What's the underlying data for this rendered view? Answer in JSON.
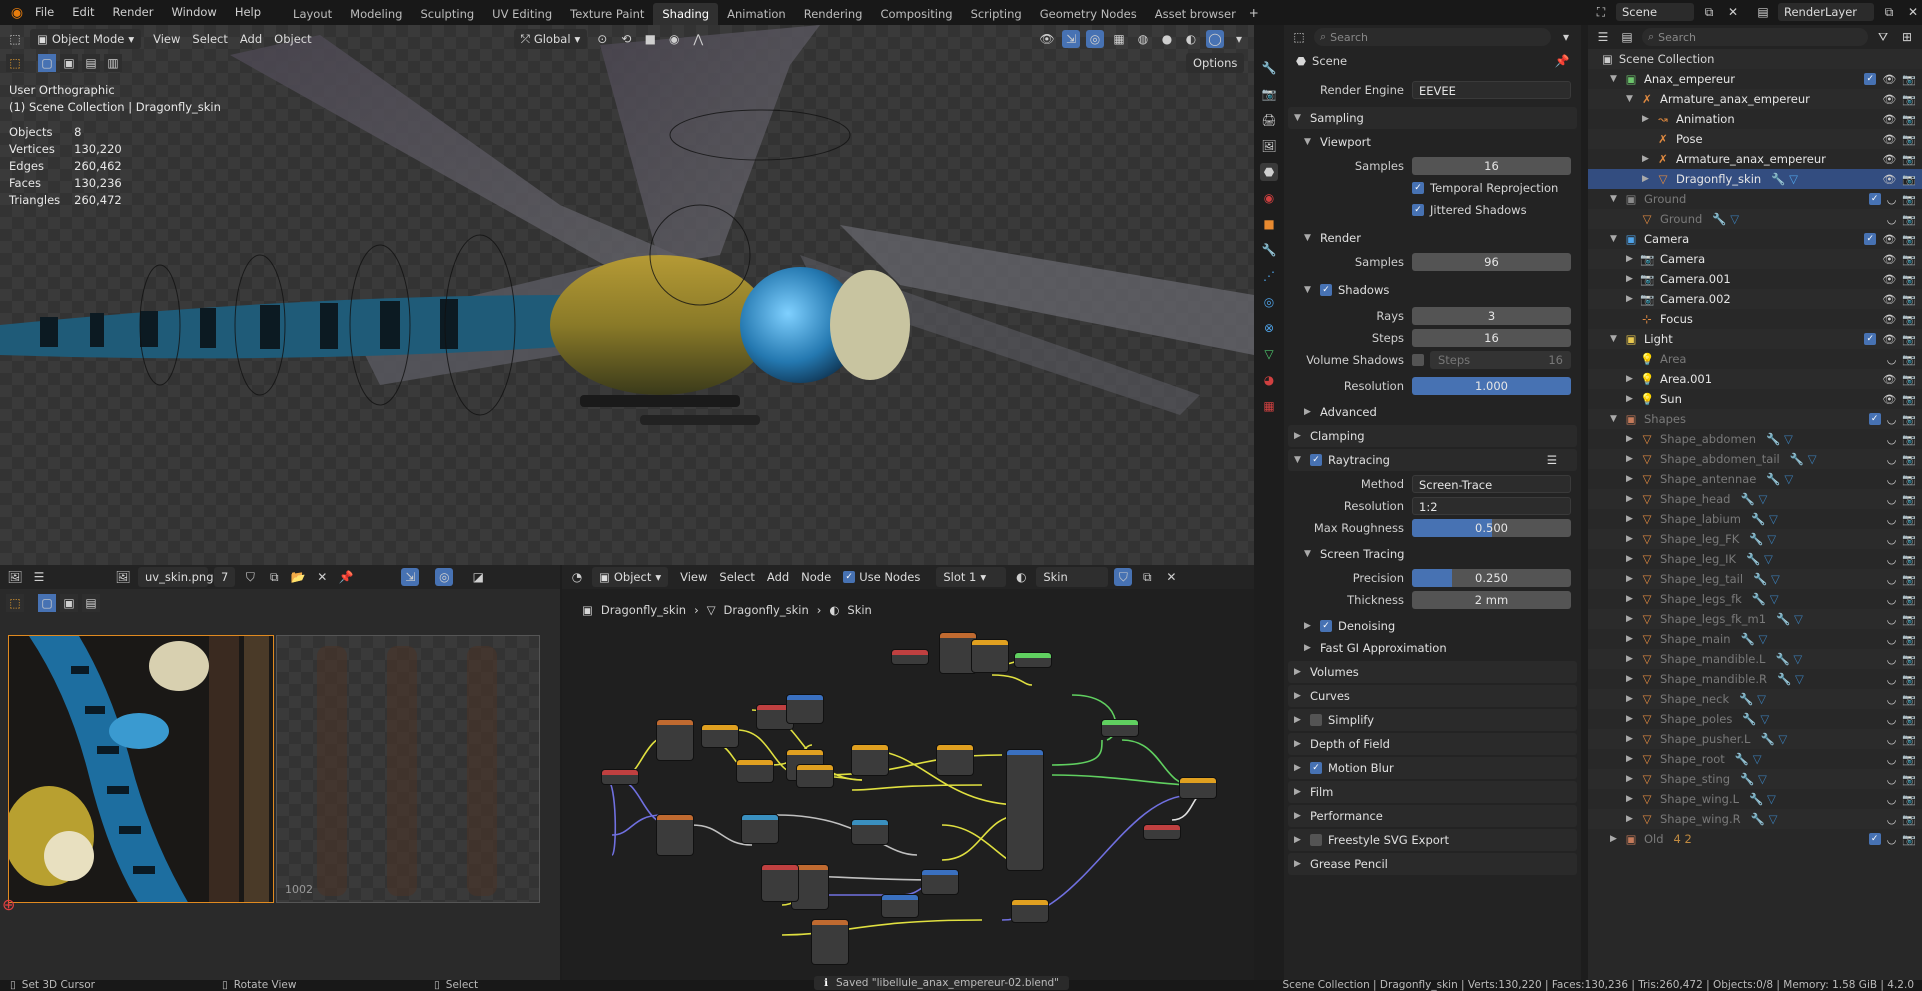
{
  "topbar": {
    "menus": [
      "File",
      "Edit",
      "Render",
      "Window",
      "Help"
    ],
    "workspaces": [
      "Layout",
      "Modeling",
      "Sculpting",
      "UV Editing",
      "Texture Paint",
      "Shading",
      "Animation",
      "Rendering",
      "Compositing",
      "Scripting",
      "Geometry Nodes",
      "Asset browser"
    ],
    "active_workspace": "Shading",
    "scene": "Scene",
    "view_layer": "RenderLayer"
  },
  "viewport": {
    "mode": "Object Mode",
    "menus": [
      "View",
      "Select",
      "Add",
      "Object"
    ],
    "transform_orientation": "Global",
    "options_label": "Options",
    "view_name": "User Orthographic",
    "collection_info": "(1) Scene Collection | Dragonfly_skin",
    "stats": [
      {
        "label": "Objects",
        "value": "8"
      },
      {
        "label": "Vertices",
        "value": "130,220"
      },
      {
        "label": "Edges",
        "value": "260,462"
      },
      {
        "label": "Faces",
        "value": "130,236"
      },
      {
        "label": "Triangles",
        "value": "260,472"
      }
    ]
  },
  "properties": {
    "search_placeholder": "Search",
    "context": "Scene",
    "render_engine_label": "Render Engine",
    "render_engine": "EEVEE",
    "sampling": "Sampling",
    "viewport": "Viewport",
    "samples_label": "Samples",
    "viewport_samples": "16",
    "temporal_reprojection": "Temporal Reprojection",
    "jittered_shadows": "Jittered Shadows",
    "render": "Render",
    "render_samples": "96",
    "shadows": "Shadows",
    "rays_label": "Rays",
    "rays": "3",
    "steps_label": "Steps",
    "steps": "16",
    "volume_shadows_label": "Volume Shadows",
    "volume_steps_label": "Steps",
    "volume_steps": "16",
    "resolution_label": "Resolution",
    "resolution": "1.000",
    "advanced": "Advanced",
    "clamping": "Clamping",
    "raytracing": "Raytracing",
    "method_label": "Method",
    "method": "Screen-Trace",
    "rt_resolution": "1:2",
    "max_roughness_label": "Max Roughness",
    "max_roughness": "0.500",
    "max_roughness_fraction": 0.5,
    "screen_tracing": "Screen Tracing",
    "precision_label": "Precision",
    "precision": "0.250",
    "precision_fraction": 0.25,
    "thickness_label": "Thickness",
    "thickness": "2 mm",
    "denoising": "Denoising",
    "fast_gi": "Fast GI Approximation",
    "panels": [
      {
        "label": "Volumes",
        "check": false
      },
      {
        "label": "Curves",
        "check": false
      },
      {
        "label": "Simplify",
        "check": "off"
      },
      {
        "label": "Depth of Field",
        "check": false
      },
      {
        "label": "Motion Blur",
        "check": "on"
      },
      {
        "label": "Film",
        "check": false
      },
      {
        "label": "Performance",
        "check": false
      },
      {
        "label": "Freestyle SVG Export",
        "check": "off"
      },
      {
        "label": "Grease Pencil",
        "check": false
      }
    ]
  },
  "outliner": {
    "search_placeholder": "Search",
    "root": "Scene Collection",
    "rows": [
      {
        "indent": 1,
        "name": "Anax_empereur",
        "type": "collection",
        "expanded": true,
        "color": "#6cc46c",
        "check": true
      },
      {
        "indent": 2,
        "name": "Armature_anax_empereur",
        "type": "armature",
        "expanded": true,
        "color": "#e8e8e8"
      },
      {
        "indent": 3,
        "name": "Animation",
        "type": "action",
        "expanded": false,
        "color": "#e8e8e8"
      },
      {
        "indent": 3,
        "name": "Pose",
        "type": "pose",
        "color": "#e8e8e8"
      },
      {
        "indent": 3,
        "name": "Armature_anax_empereur",
        "type": "armature-data",
        "expanded": false,
        "color": "#e8e8e8"
      },
      {
        "indent": 3,
        "name": "Dragonfly_skin",
        "type": "mesh",
        "expanded": false,
        "color": "#e8e8e8",
        "selected": true
      },
      {
        "indent": 1,
        "name": "Ground",
        "type": "collection",
        "expanded": true,
        "color": "#8a8a8a",
        "dim": true,
        "check": true
      },
      {
        "indent": 2,
        "name": "Ground",
        "type": "mesh",
        "color": "#8a8a8a",
        "dim": true
      },
      {
        "indent": 1,
        "name": "Camera",
        "type": "collection",
        "expanded": true,
        "color": "#4fa3e8",
        "check": true
      },
      {
        "indent": 2,
        "name": "Camera",
        "type": "camera",
        "expanded": false,
        "color": "#e8e8e8"
      },
      {
        "indent": 2,
        "name": "Camera.001",
        "type": "camera",
        "expanded": false,
        "color": "#e8e8e8"
      },
      {
        "indent": 2,
        "name": "Camera.002",
        "type": "camera",
        "expanded": false,
        "color": "#e8e8e8"
      },
      {
        "indent": 2,
        "name": "Focus",
        "type": "empty",
        "color": "#e8e8e8"
      },
      {
        "indent": 1,
        "name": "Light",
        "type": "collection",
        "expanded": true,
        "color": "#e8c84f",
        "check": true
      },
      {
        "indent": 2,
        "name": "Area",
        "type": "light",
        "color": "#8a8a8a",
        "dim": true
      },
      {
        "indent": 2,
        "name": "Area.001",
        "type": "light",
        "expanded": false,
        "color": "#e8e8e8"
      },
      {
        "indent": 2,
        "name": "Sun",
        "type": "light",
        "expanded": false,
        "color": "#e8e8e8"
      },
      {
        "indent": 1,
        "name": "Shapes",
        "type": "collection",
        "expanded": true,
        "color": "#c47a5a",
        "dim": true,
        "check": true
      },
      {
        "indent": 2,
        "name": "Shape_abdomen",
        "type": "mesh",
        "expanded": false,
        "dim": true
      },
      {
        "indent": 2,
        "name": "Shape_abdomen_tail",
        "type": "mesh",
        "expanded": false,
        "dim": true
      },
      {
        "indent": 2,
        "name": "Shape_antennae",
        "type": "mesh",
        "expanded": false,
        "dim": true
      },
      {
        "indent": 2,
        "name": "Shape_head",
        "type": "mesh",
        "expanded": false,
        "dim": true
      },
      {
        "indent": 2,
        "name": "Shape_labium",
        "type": "mesh",
        "expanded": false,
        "dim": true
      },
      {
        "indent": 2,
        "name": "Shape_leg_FK",
        "type": "mesh",
        "expanded": false,
        "dim": true
      },
      {
        "indent": 2,
        "name": "Shape_leg_IK",
        "type": "mesh",
        "expanded": false,
        "dim": true
      },
      {
        "indent": 2,
        "name": "Shape_leg_tail",
        "type": "mesh",
        "expanded": false,
        "dim": true
      },
      {
        "indent": 2,
        "name": "Shape_legs_fk",
        "type": "mesh",
        "expanded": false,
        "dim": true
      },
      {
        "indent": 2,
        "name": "Shape_legs_fk_m1",
        "type": "mesh",
        "expanded": false,
        "dim": true
      },
      {
        "indent": 2,
        "name": "Shape_main",
        "type": "mesh",
        "expanded": false,
        "dim": true
      },
      {
        "indent": 2,
        "name": "Shape_mandible.L",
        "type": "mesh",
        "expanded": false,
        "dim": true
      },
      {
        "indent": 2,
        "name": "Shape_mandible.R",
        "type": "mesh",
        "expanded": false,
        "dim": true
      },
      {
        "indent": 2,
        "name": "Shape_neck",
        "type": "mesh",
        "expanded": false,
        "dim": true
      },
      {
        "indent": 2,
        "name": "Shape_poles",
        "type": "mesh",
        "expanded": false,
        "dim": true
      },
      {
        "indent": 2,
        "name": "Shape_pusher.L",
        "type": "mesh",
        "expanded": false,
        "dim": true
      },
      {
        "indent": 2,
        "name": "Shape_root",
        "type": "mesh",
        "expanded": false,
        "dim": true
      },
      {
        "indent": 2,
        "name": "Shape_sting",
        "type": "mesh",
        "expanded": false,
        "dim": true
      },
      {
        "indent": 2,
        "name": "Shape_wing.L",
        "type": "mesh",
        "expanded": false,
        "dim": true
      },
      {
        "indent": 2,
        "name": "Shape_wing.R",
        "type": "mesh",
        "expanded": false,
        "dim": true
      },
      {
        "indent": 1,
        "name": "Old",
        "type": "collection",
        "expanded": false,
        "color": "#c47a5a",
        "dim": true,
        "check": true,
        "extra": "4 2"
      }
    ]
  },
  "image_editor": {
    "image_name": "uv_skin.png",
    "users": "7",
    "tile_label": "1002"
  },
  "node_editor": {
    "object_mode": "Object",
    "menus": [
      "View",
      "Select",
      "Add",
      "Node"
    ],
    "use_nodes": "Use Nodes",
    "slot": "Slot 1",
    "material": "Skin",
    "breadcrumb": [
      "Dragonfly_skin",
      "Dragonfly_skin",
      "Skin"
    ]
  },
  "status": {
    "left": [
      "Set 3D Cursor",
      "Rotate View",
      "Select"
    ],
    "message": "Saved \"libellule_anax_empereur-02.blend\"",
    "right": "Scene Collection | Dragonfly_skin | Verts:130,220 | Faces:130,236 | Tris:260,472 | Objects:0/8 | Memory: 1.58 GiB | 4.2.0"
  }
}
